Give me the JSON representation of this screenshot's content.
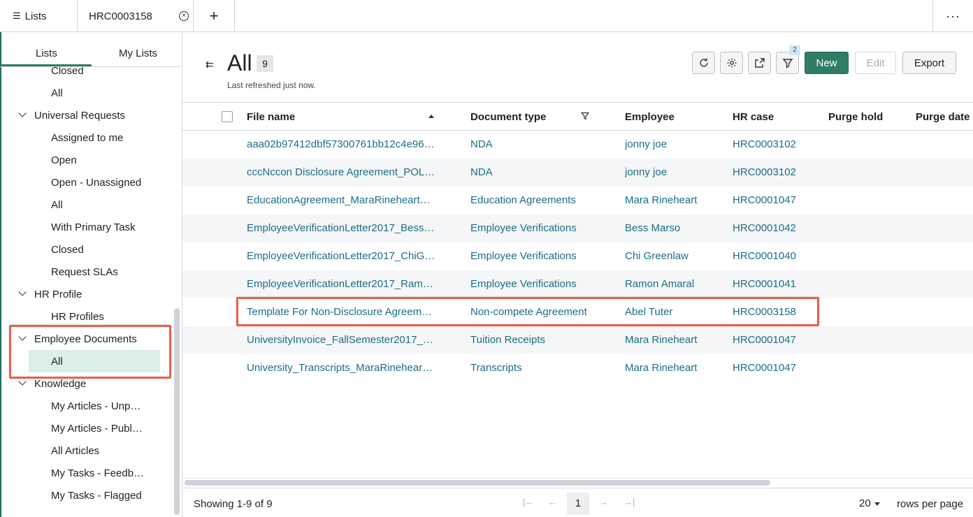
{
  "tabs": {
    "lists_label": "Lists",
    "case_label": "HRC0003158",
    "add_label": "+",
    "more_label": "···"
  },
  "sidebar": {
    "sub_tabs": [
      "Lists",
      "My Lists"
    ],
    "items": [
      {
        "label": "Closed",
        "type": "child"
      },
      {
        "label": "All",
        "type": "child"
      },
      {
        "label": "Universal Requests",
        "type": "group"
      },
      {
        "label": "Assigned to me",
        "type": "child"
      },
      {
        "label": "Open",
        "type": "child"
      },
      {
        "label": "Open - Unassigned",
        "type": "child"
      },
      {
        "label": "All",
        "type": "child"
      },
      {
        "label": "With Primary Task",
        "type": "child"
      },
      {
        "label": "Closed",
        "type": "child"
      },
      {
        "label": "Request SLAs",
        "type": "child"
      },
      {
        "label": "HR Profile",
        "type": "group"
      },
      {
        "label": "HR Profiles",
        "type": "child"
      },
      {
        "label": "Employee Documents",
        "type": "group"
      },
      {
        "label": "All",
        "type": "child",
        "selected": true
      },
      {
        "label": "Knowledge",
        "type": "group"
      },
      {
        "label": "My Articles - Unp…",
        "type": "child"
      },
      {
        "label": "My Articles - Publ…",
        "type": "child"
      },
      {
        "label": "All Articles",
        "type": "child"
      },
      {
        "label": "My Tasks - Feedb…",
        "type": "child"
      },
      {
        "label": "My Tasks - Flagged",
        "type": "child"
      }
    ]
  },
  "header": {
    "title": "All",
    "count": "9",
    "refreshed": "Last refreshed just now.",
    "filter_badge": "2",
    "new_label": "New",
    "edit_label": "Edit",
    "export_label": "Export"
  },
  "table": {
    "columns": [
      "File name",
      "Document type",
      "Employee",
      "HR case",
      "Purge hold",
      "Purge date"
    ],
    "rows": [
      {
        "file": "aaa02b97412dbf57300761bb12c4e96…",
        "doc": "NDA",
        "emp": "jonny joe",
        "case": "HRC0003102"
      },
      {
        "file": "cccNccon Disclosure Agreement_POL…",
        "doc": "NDA",
        "emp": "jonny joe",
        "case": "HRC0003102"
      },
      {
        "file": "EducationAgreement_MaraRineheart…",
        "doc": "Education Agreements",
        "emp": "Mara Rineheart",
        "case": "HRC0001047"
      },
      {
        "file": "EmployeeVerificationLetter2017_Bess…",
        "doc": "Employee Verifications",
        "emp": "Bess Marso",
        "case": "HRC0001042"
      },
      {
        "file": "EmployeeVerificationLetter2017_ChiG…",
        "doc": "Employee Verifications",
        "emp": "Chi Greenlaw",
        "case": "HRC0001040"
      },
      {
        "file": "EmployeeVerificationLetter2017_Ram…",
        "doc": "Employee Verifications",
        "emp": "Ramon Amaral",
        "case": "HRC0001041"
      },
      {
        "file": "Template For Non-Disclosure Agreem…",
        "doc": "Non-compete Agreement",
        "emp": "Abel Tuter",
        "case": "HRC0003158"
      },
      {
        "file": "UniversityInvoice_FallSemester2017_…",
        "doc": "Tuition Receipts",
        "emp": "Mara Rineheart",
        "case": "HRC0001047"
      },
      {
        "file": "University_Transcripts_MaraRinehear…",
        "doc": "Transcripts",
        "emp": "Mara Rineheart",
        "case": "HRC0001047"
      }
    ]
  },
  "footer": {
    "showing": "Showing 1-9 of 9",
    "page": "1",
    "rows_per_page_value": "20",
    "rows_per_page_label": "rows per page"
  },
  "colors": {
    "accent": "#2e7d66",
    "link": "#1b6d86",
    "highlight": "#e8604c",
    "selected_bg": "#dceee8"
  }
}
